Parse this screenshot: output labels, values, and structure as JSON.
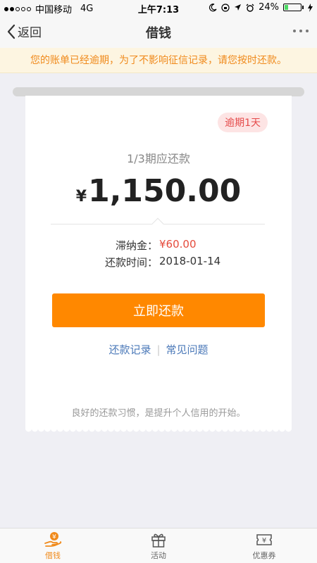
{
  "status_bar": {
    "carrier": "中国移动",
    "network": "4G",
    "time": "上午7:13",
    "battery_percent": "24%",
    "battery_level": 0.24
  },
  "nav": {
    "back_label": "返回",
    "title": "借钱"
  },
  "notice": {
    "text": "您的账单已经逾期，为了不影响征信记录，请您按时还款。"
  },
  "bill": {
    "overdue_badge": "逾期1天",
    "period_label": "1/3期应还款",
    "currency_symbol": "¥",
    "amount": "1,150.00",
    "late_fee_label": "滞纳金：",
    "late_fee_value": "¥60.00",
    "due_date_label": "还款时间：",
    "due_date_value": "2018-01-14",
    "repay_button": "立即还款",
    "link_records": "还款记录",
    "link_faq": "常见问题",
    "footer_tip": "良好的还款习惯，是提升个人信用的开始。"
  },
  "tabs": [
    {
      "label": "借钱",
      "icon": "hand-yen-icon",
      "active": true
    },
    {
      "label": "活动",
      "icon": "gift-icon",
      "active": false
    },
    {
      "label": "优惠券",
      "icon": "coupon-icon",
      "active": false
    }
  ],
  "colors": {
    "accent": "#ff8800",
    "notice_text": "#f08a1c",
    "overdue": "#e54b4b",
    "link": "#4a78b8"
  }
}
